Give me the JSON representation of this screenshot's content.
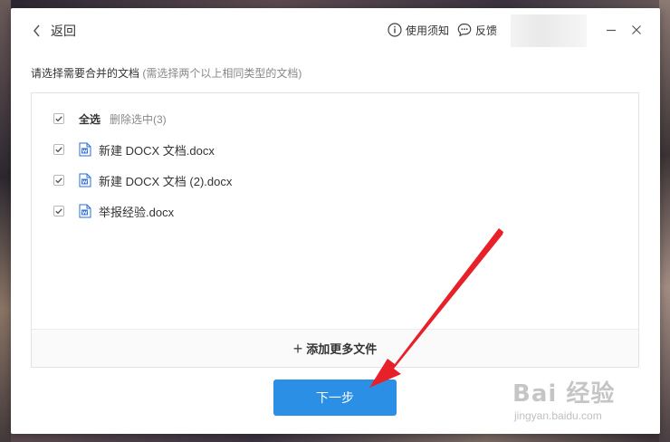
{
  "titlebar": {
    "back_label": "返回",
    "notice_label": "使用须知",
    "feedback_label": "反馈"
  },
  "instruction": {
    "main": "请选择需要合并的文档",
    "hint": "(需选择两个以上相同类型的文档)"
  },
  "file_list": {
    "select_all_label": "全选",
    "delete_selected_label": "删除选中(3)",
    "files": [
      {
        "name": "新建 DOCX 文档.docx",
        "checked": true
      },
      {
        "name": "新建 DOCX 文档 (2).docx",
        "checked": true
      },
      {
        "name": "举报经验.docx",
        "checked": true
      }
    ]
  },
  "add_more": {
    "label": "添加更多文件"
  },
  "next_button": {
    "label": "下一步"
  },
  "watermark": {
    "logo": "Bai 经验",
    "url": "jingyan.baidu.com"
  },
  "colors": {
    "primary": "#2b8fe6",
    "arrow": "#e8202a",
    "word_icon": "#2b6cd8"
  }
}
